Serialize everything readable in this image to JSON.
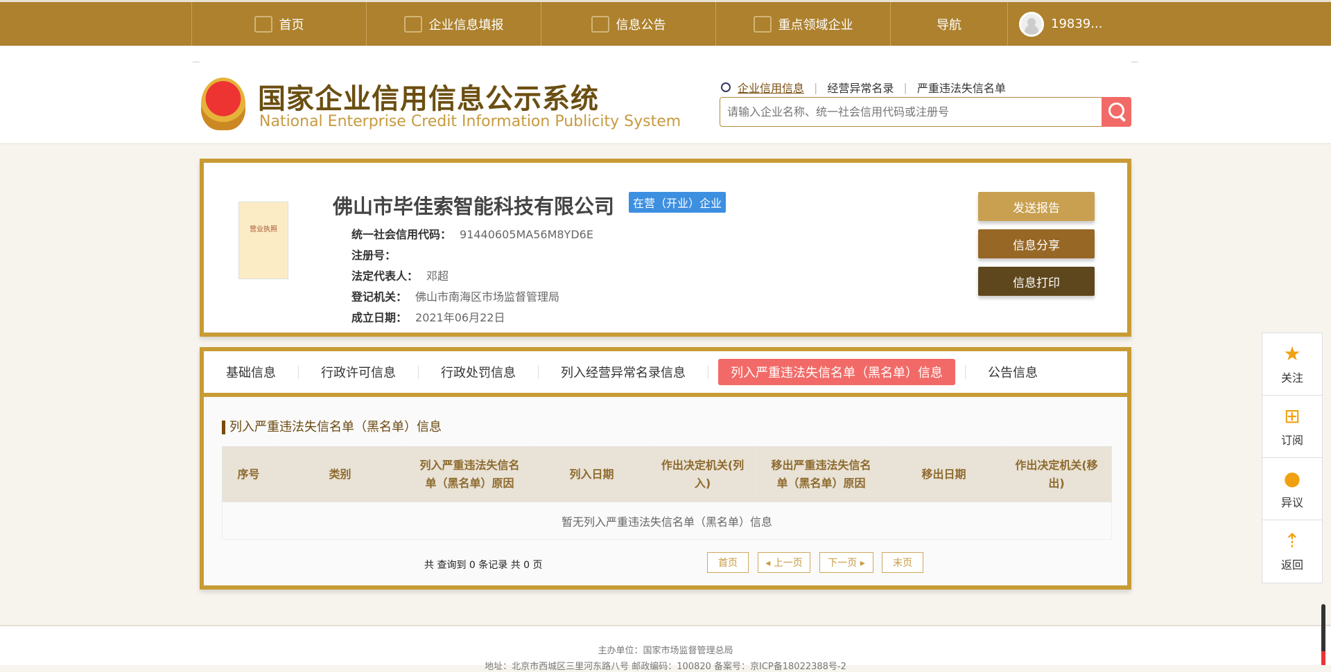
{
  "nav": {
    "items": [
      {
        "label": "首页",
        "icon": "monitor-icon"
      },
      {
        "label": "企业信息填报",
        "icon": "pen-icon"
      },
      {
        "label": "信息公告",
        "icon": "document-icon"
      },
      {
        "label": "重点领域企业",
        "icon": "speaker-icon"
      },
      {
        "label": "导航"
      }
    ],
    "user": "19839..."
  },
  "header": {
    "title_cn": "国家企业信用信息公示系统",
    "title_en": "National Enterprise Credit Information Publicity System",
    "links": [
      "企业信用信息",
      "经营异常名录",
      "严重违法失信名单"
    ],
    "search_placeholder": "请输入企业名称、统一社会信用代码或注册号"
  },
  "company": {
    "name": "佛山市毕佳索智能科技有限公司",
    "status": "在营（开业）企业",
    "license_label": "营业执照",
    "fields": [
      {
        "label": "统一社会信用代码：",
        "value": "91440605MA56M8YD6E"
      },
      {
        "label": "注册号：",
        "value": ""
      },
      {
        "label": "法定代表人：",
        "value": "邓超"
      },
      {
        "label": "登记机关：",
        "value": "佛山市南海区市场监督管理局"
      },
      {
        "label": "成立日期：",
        "value": "2021年06月22日"
      }
    ],
    "buttons": [
      "发送报告",
      "信息分享",
      "信息打印"
    ]
  },
  "tabs": [
    "基础信息",
    "行政许可信息",
    "行政处罚信息",
    "列入经营异常名录信息",
    "列入严重违法失信名单（黑名单）信息",
    "公告信息"
  ],
  "section": {
    "title": "列入严重违法失信名单（黑名单）信息",
    "columns": [
      "序号",
      "类别",
      "列入严重违法失信名单（黑名单）原因",
      "列入日期",
      "作出决定机关(列入)",
      "移出严重违法失信名单（黑名单）原因",
      "移出日期",
      "作出决定机关(移出)"
    ],
    "empty": "暂无列入严重违法失信名单（黑名单）信息"
  },
  "pager": {
    "info": "共 查询到 0 条记录 共 0 页",
    "first": "首页",
    "prev": "◂ 上一页",
    "next": "下一页 ▸",
    "last": "末页"
  },
  "float": [
    {
      "label": "关注",
      "icon": "star-icon"
    },
    {
      "label": "订阅",
      "icon": "plus-icon"
    },
    {
      "label": "异议",
      "icon": "chat-icon"
    },
    {
      "label": "返回",
      "icon": "arrow-up-icon"
    }
  ],
  "footer": {
    "line1": "主办单位：国家市场监督管理总局",
    "line2": "地址：北京市西城区三里河东路八号  邮政编码：100820  备案号：京ICP备18022388号-2"
  }
}
